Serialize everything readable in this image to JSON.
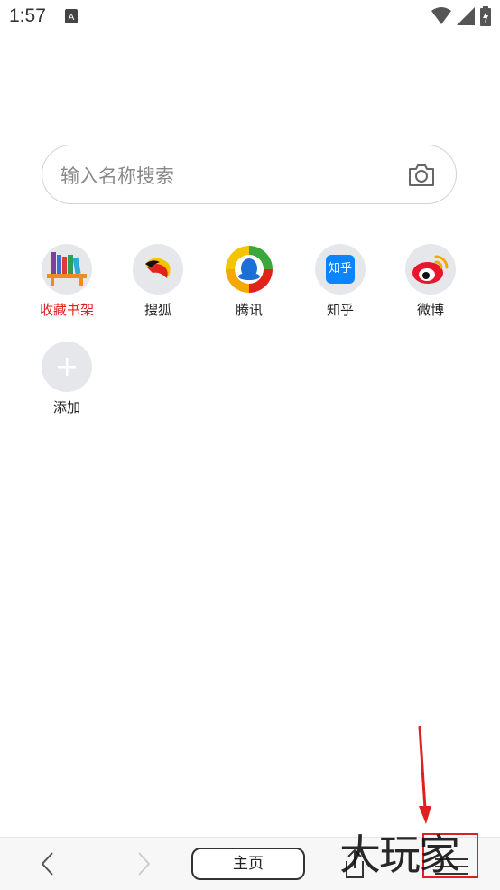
{
  "status_bar": {
    "time": "1:57"
  },
  "search": {
    "placeholder": "输入名称搜索"
  },
  "shortcuts": [
    {
      "label": "收藏书架",
      "icon": "bookshelf-icon"
    },
    {
      "label": "搜狐",
      "icon": "sohu-icon"
    },
    {
      "label": "腾讯",
      "icon": "tencent-icon"
    },
    {
      "label": "知乎",
      "icon": "zhihu-icon",
      "badge": "知乎"
    },
    {
      "label": "微博",
      "icon": "weibo-icon"
    },
    {
      "label": "添加",
      "icon": "plus-icon"
    }
  ],
  "bottom_bar": {
    "home_label": "主页"
  },
  "colors": {
    "accent_red": "#e02020",
    "zhihu_blue": "#0a84ff"
  },
  "watermark": "大玩家"
}
